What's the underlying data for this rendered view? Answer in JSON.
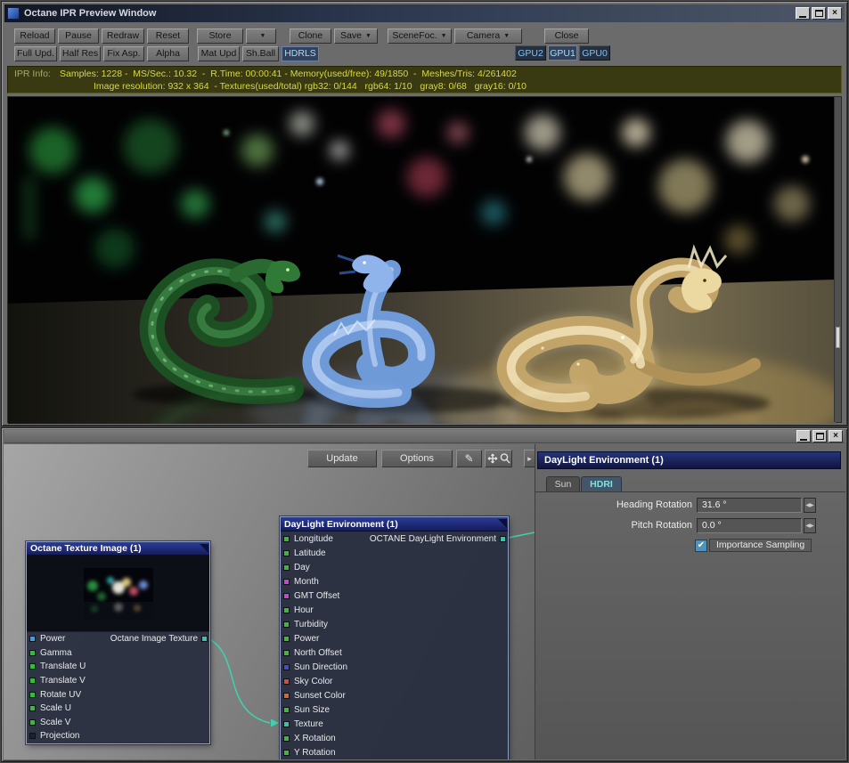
{
  "colors": {
    "wire": "#3fd0ae",
    "accent_navy": "#1b2461",
    "info_bg": "#3a3a12",
    "info_text": "#d9d93e",
    "port_green": "#3cb83c",
    "port_magenta": "#cc44cc",
    "port_blue": "#4848d8",
    "port_red": "#d84848",
    "port_teal": "#35c4a5"
  },
  "ipr": {
    "title": "Octane IPR Preview Window",
    "row1": {
      "reload": "Reload",
      "pause": "Pause",
      "redraw": "Redraw",
      "reset": "Reset",
      "store": "Store",
      "clone": "Clone",
      "save": "Save",
      "scenefoc": "SceneFoc.",
      "camera": "Camera",
      "close": "Close"
    },
    "row2": {
      "full_upd": "Full Upd.",
      "half_res": "Half Res",
      "fix_asp": "Fix Asp.",
      "alpha": "Alpha",
      "mat_upd": "Mat Upd",
      "sh_ball": "Sh.Ball",
      "hdrls": "HDRLS",
      "gpu2": "GPU2",
      "gpu1": "GPU1",
      "gpu0": "GPU0"
    },
    "info": {
      "label": "IPR Info:",
      "line1": "Samples: 1228 -  MS/Sec.: 10.32  -  R.Time: 00:00:41 - Memory(used/free): 49/1850  -  Meshes/Tris: 4/261402",
      "line2": "Image resolution: 932 x 364  - Textures(used/total) rgb32: 0/144   rgb64: 1/10   gray8: 0/68   gray16: 0/10"
    }
  },
  "editor": {
    "toolbar": {
      "update": "Update",
      "options": "Options"
    },
    "panel": {
      "title": "DayLight Environment (1)",
      "tab_sun": "Sun",
      "tab_hdri": "HDRI",
      "active_tab": "HDRI",
      "heading_rotation": {
        "label": "Heading Rotation",
        "value": "31.6 °"
      },
      "pitch_rotation": {
        "label": "Pitch Rotation",
        "value": "0.0 °"
      },
      "importance_sampling": {
        "label": "Importance Sampling",
        "checked": true
      }
    },
    "nodes": {
      "texture": {
        "title": "Octane Texture Image (1)",
        "output_label": "Octane Image Texture",
        "inputs": [
          {
            "label": "Power",
            "color": "#4a9ad4"
          },
          {
            "label": "Gamma",
            "color": "#3cb83c"
          },
          {
            "label": "Translate U",
            "color": "#3cb83c"
          },
          {
            "label": "Translate V",
            "color": "#3cb83c"
          },
          {
            "label": "Rotate UV",
            "color": "#3cb83c"
          },
          {
            "label": "Scale U",
            "color": "#3cb83c"
          },
          {
            "label": "Scale V",
            "color": "#3cb83c"
          },
          {
            "label": "Projection",
            "color": "#1c222c"
          }
        ]
      },
      "daylight": {
        "title": "DayLight Environment (1)",
        "output_label": "OCTANE DayLight Environment",
        "inputs": [
          {
            "label": "Longitude",
            "color": "#3cb83c"
          },
          {
            "label": "Latitude",
            "color": "#3cb83c"
          },
          {
            "label": "Day",
            "color": "#3cb83c"
          },
          {
            "label": "Month",
            "color": "#cc44cc"
          },
          {
            "label": "GMT Offset",
            "color": "#cc44cc"
          },
          {
            "label": "Hour",
            "color": "#3cb83c"
          },
          {
            "label": "Turbidity",
            "color": "#3cb83c"
          },
          {
            "label": "Power",
            "color": "#3cb83c"
          },
          {
            "label": "North Offset",
            "color": "#3cb83c"
          },
          {
            "label": "Sun Direction",
            "color": "#4848d8"
          },
          {
            "label": "Sky Color",
            "color": "#d84848"
          },
          {
            "label": "Sunset Color",
            "color": "#d8662a"
          },
          {
            "label": "Sun Size",
            "color": "#3cb83c"
          },
          {
            "label": "Texture",
            "color": "#35c4a5"
          },
          {
            "label": "X Rotation",
            "color": "#3cb83c"
          },
          {
            "label": "Y Rotation",
            "color": "#3cb83c"
          }
        ]
      }
    }
  }
}
